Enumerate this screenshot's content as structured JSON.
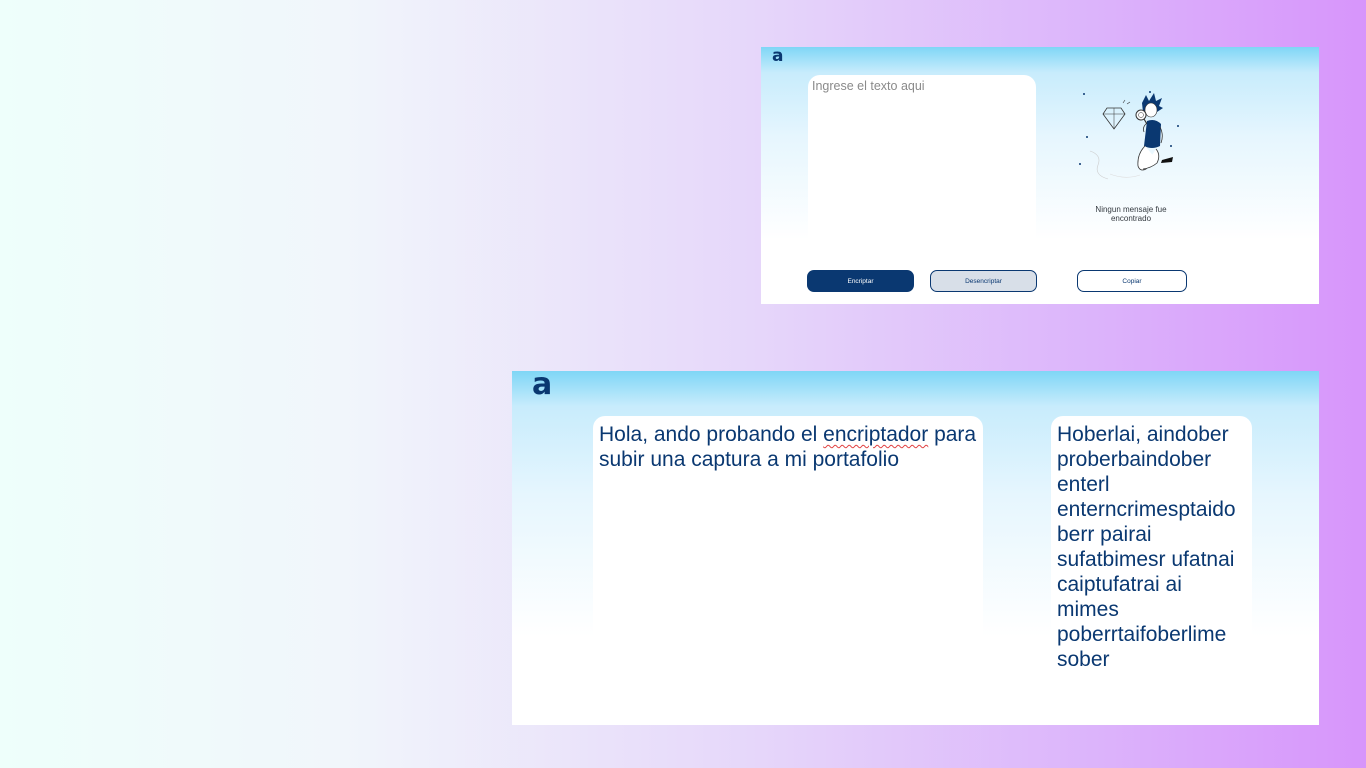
{
  "colors": {
    "primary": "#0a3871",
    "secondary_button": "#d8dfe8"
  },
  "screenshot_top": {
    "logo": "a",
    "input": {
      "placeholder": "Ingrese el texto aqui"
    },
    "illustration": "person-with-magnifier-and-diamond",
    "empty_message": "Ningun mensaje fue encontrado",
    "buttons": {
      "encrypt": "Encriptar",
      "decrypt": "Desencriptar",
      "copy": "Copiar"
    }
  },
  "screenshot_bottom": {
    "logo": "a",
    "input": {
      "text_before": "Hola, ando probando el ",
      "text_misspelled": "encriptador",
      "text_after": " para subir una captura a mi portafolio"
    },
    "output": "Hoberlai, aindober proberbaindober enterl enterncrimesptaidoberr pairai sufatbimesr ufatnai caiptufatrai ai mimes poberrtaifoberlime sober"
  }
}
